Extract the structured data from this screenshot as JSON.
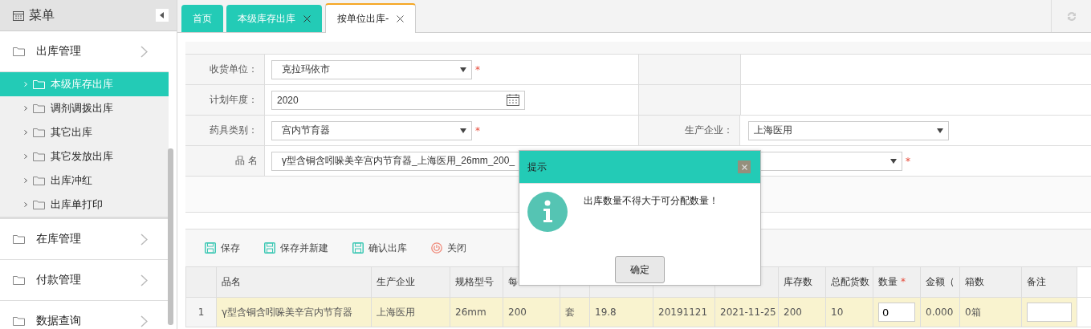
{
  "sidebar": {
    "title": "菜单",
    "groups": [
      {
        "label": "出库管理",
        "expanded": true,
        "children": [
          {
            "label": "本级库存出库",
            "selected": true
          },
          {
            "label": "调剂调拨出库",
            "selected": false
          },
          {
            "label": "其它出库",
            "selected": false
          },
          {
            "label": "其它发放出库",
            "selected": false
          },
          {
            "label": "出库冲红",
            "selected": false
          },
          {
            "label": "出库单打印",
            "selected": false
          }
        ]
      },
      {
        "label": "在库管理",
        "expanded": false
      },
      {
        "label": "付款管理",
        "expanded": false
      },
      {
        "label": "数据查询",
        "expanded": false
      }
    ]
  },
  "tabs": [
    {
      "label": "首页",
      "selected": false,
      "closable": false
    },
    {
      "label": "本级库存出库",
      "selected": false,
      "closable": true
    },
    {
      "label": "按单位出库-",
      "selected": true,
      "closable": true
    }
  ],
  "form": {
    "consignee": {
      "label": "收货单位：",
      "value": "克拉玛依市",
      "required_mark": "*"
    },
    "plan_year": {
      "label": "计划年度：",
      "value": "2020"
    },
    "category": {
      "label": "药具类别：",
      "value": "宫内节育器",
      "required_mark": "*"
    },
    "manufacturer": {
      "label": "生产企业：",
      "value": "上海医用"
    },
    "product": {
      "label": "品 名",
      "value": "γ型含铜含吲哚美辛宫内节育器_上海医用_26mm_200_",
      "required_mark": "*"
    }
  },
  "toolbar": [
    {
      "label": "保存",
      "kind": "save"
    },
    {
      "label": "保存并新建",
      "kind": "save"
    },
    {
      "label": "确认出库",
      "kind": "save"
    },
    {
      "label": "关闭",
      "kind": "close"
    }
  ],
  "table": {
    "columns": [
      {},
      {
        "label": "品名"
      },
      {
        "label": "生产企业"
      },
      {
        "label": "规格型号"
      },
      {
        "label": "每"
      },
      {},
      {},
      {},
      {},
      {
        "label": "库存数"
      },
      {
        "label": "总配货数"
      },
      {
        "label": "数量",
        "required_mark": "*"
      },
      {
        "label": "金额（"
      },
      {
        "label": "箱数"
      },
      {
        "label": "备注"
      }
    ],
    "rows": [
      {
        "cells": [
          {
            "kind": "index",
            "text": "1"
          },
          {
            "kind": "text",
            "text": "γ型含铜含吲哚美辛宫内节育器"
          },
          {
            "kind": "text",
            "text": "上海医用"
          },
          {
            "kind": "text",
            "text": "26mm"
          },
          {
            "kind": "text",
            "text": "200"
          },
          {
            "kind": "text",
            "text": "套"
          },
          {
            "kind": "text",
            "text": "19.8"
          },
          {
            "kind": "text",
            "text": "20191121"
          },
          {
            "kind": "text",
            "text": "2021-11-25"
          },
          {
            "kind": "text",
            "text": "200"
          },
          {
            "kind": "text",
            "text": "10"
          },
          {
            "kind": "input",
            "text": "0"
          },
          {
            "kind": "text",
            "text": "0.000"
          },
          {
            "kind": "text",
            "text": "0箱"
          },
          {
            "kind": "input"
          }
        ]
      }
    ]
  },
  "dialog": {
    "title": "提示",
    "message": "出库数量不得大于可分配数量！",
    "button": "确定"
  }
}
